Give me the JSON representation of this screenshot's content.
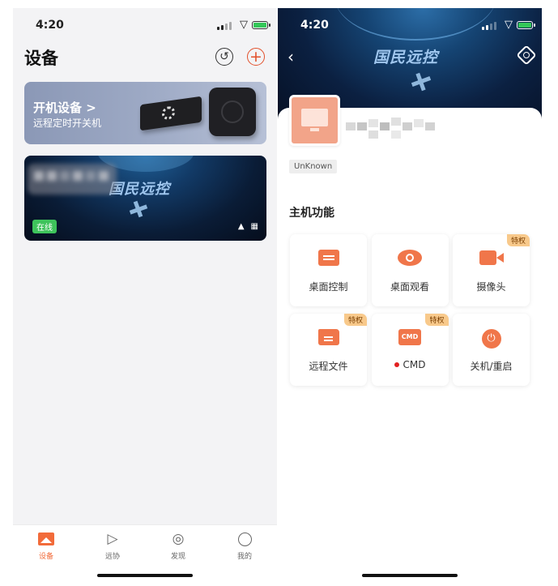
{
  "left_screen": {
    "status": {
      "time": "4:20"
    },
    "title": "设备",
    "header_icons": {
      "history": "history-icon",
      "add": "plus-icon"
    },
    "banner": {
      "title": "开机设备 >",
      "subtitle": "远程定时开关机"
    },
    "device_card": {
      "logo_text": "国民远控",
      "status": "在线",
      "icons": [
        "bell-icon",
        "windows-icon"
      ]
    },
    "tabs": [
      {
        "label": "设备",
        "icon": "image-icon",
        "active": true
      },
      {
        "label": "远协",
        "icon": "send-icon",
        "active": false
      },
      {
        "label": "发现",
        "icon": "compass-icon",
        "active": false
      },
      {
        "label": "我的",
        "icon": "smile-icon",
        "active": false
      }
    ]
  },
  "right_screen": {
    "status": {
      "time": "4:20"
    },
    "hero_logo": "国民远控",
    "tag": "UnKnown",
    "section_title": "主机功能",
    "functions": [
      {
        "label": "桌面控制",
        "icon": "desktop-control-icon",
        "badge": ""
      },
      {
        "label": "桌面观看",
        "icon": "eye-icon",
        "badge": ""
      },
      {
        "label": "摄像头",
        "icon": "camera-icon",
        "badge": "特权"
      },
      {
        "label": "远程文件",
        "icon": "folder-icon",
        "badge": "特权"
      },
      {
        "label": "CMD",
        "icon": "cmd-icon",
        "badge": "特权",
        "icon_text": "CMD"
      },
      {
        "label": "关机/重启",
        "icon": "power-icon",
        "badge": ""
      }
    ]
  },
  "accent_color": "#f0764a",
  "online_color": "#3ec35b"
}
